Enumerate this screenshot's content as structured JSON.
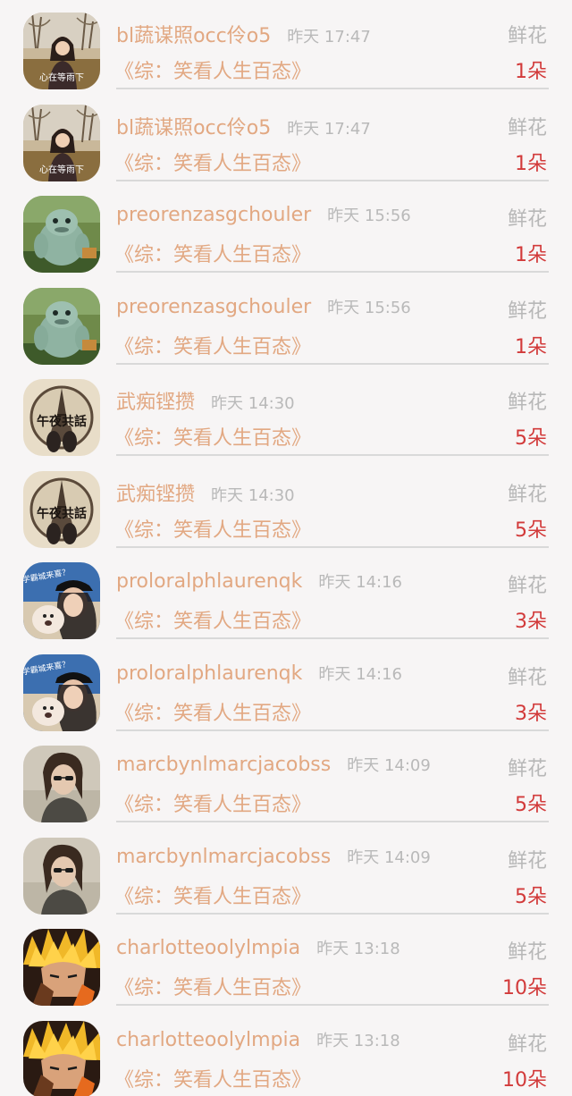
{
  "gift_label": "鲜花",
  "rows": [
    {
      "user": "bl蔬谋照occ伶o5",
      "time": "昨天 17:47",
      "title": "《综：笑看人生百态》",
      "count": "1朵",
      "avatar": "rain-woman"
    },
    {
      "user": "bl蔬谋照occ伶o5",
      "time": "昨天 17:47",
      "title": "《综：笑看人生百态》",
      "count": "1朵",
      "avatar": "rain-woman"
    },
    {
      "user": "preorenzasgchouler",
      "time": "昨天 15:56",
      "title": "《综：笑看人生百态》",
      "count": "1朵",
      "avatar": "green-monster"
    },
    {
      "user": "preorenzasgchouler",
      "time": "昨天 15:56",
      "title": "《综：笑看人生百态》",
      "count": "1朵",
      "avatar": "green-monster"
    },
    {
      "user": "武痴铿攒",
      "time": "昨天 14:30",
      "title": "《综：笑看人生百态》",
      "count": "5朵",
      "avatar": "eiffel-tower"
    },
    {
      "user": "武痴铿攒",
      "time": "昨天 14:30",
      "title": "《综：笑看人生百态》",
      "count": "5朵",
      "avatar": "eiffel-tower"
    },
    {
      "user": "proloralphlaurenqk",
      "time": "昨天 14:16",
      "title": "《综：笑看人生百态》",
      "count": "3朵",
      "avatar": "cap-with-dog"
    },
    {
      "user": "proloralphlaurenqk",
      "time": "昨天 14:16",
      "title": "《综：笑看人生百态》",
      "count": "3朵",
      "avatar": "cap-with-dog"
    },
    {
      "user": "marcbynlmarcjacobss",
      "time": "昨天 14:09",
      "title": "《综：笑看人生百态》",
      "count": "5朵",
      "avatar": "long-hair-man"
    },
    {
      "user": "marcbynlmarcjacobss",
      "time": "昨天 14:09",
      "title": "《综：笑看人生百态》",
      "count": "5朵",
      "avatar": "long-hair-man"
    },
    {
      "user": "charlotteoolylmpia",
      "time": "昨天 13:18",
      "title": "《综：笑看人生百态》",
      "count": "10朵",
      "avatar": "spiky-anime"
    },
    {
      "user": "charlotteoolylmpia",
      "time": "昨天 13:18",
      "title": "《综：笑看人生百态》",
      "count": "10朵",
      "avatar": "spiky-anime"
    }
  ],
  "avatar_texts": {
    "rain-woman": "心在等雨下",
    "eiffel-tower": "午夜共話",
    "cap-with-dog": "学霸城来喜？"
  },
  "colors": {
    "background": "#f7f5f5",
    "name": "#e2a882",
    "time": "#b9b9b9",
    "count": "#d23a3a",
    "gift_label": "#b7b7b7"
  }
}
